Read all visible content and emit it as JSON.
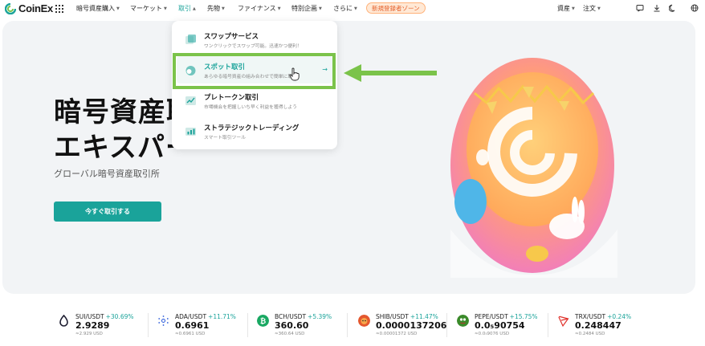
{
  "nav": {
    "logo": "CoinEx",
    "items": [
      {
        "label": "暗号資産購入",
        "active": false
      },
      {
        "label": "マーケット",
        "active": false
      },
      {
        "label": "取引",
        "active": true
      },
      {
        "label": "先物",
        "active": false
      },
      {
        "label": "ファイナンス",
        "active": false
      },
      {
        "label": "特別企画",
        "active": false
      },
      {
        "label": "さらに",
        "active": false
      }
    ],
    "promo": "新規登録者ゾーン",
    "assets": "資産",
    "orders": "注文"
  },
  "hero": {
    "title_line1": "暗号資産取",
    "title_line2": "エキスパー",
    "subtitle": "グローバル暗号資産取引所",
    "cta": "今すぐ取引する"
  },
  "menu": {
    "items": [
      {
        "title": "スワップサービス",
        "desc": "ワンクリックでスワップ可能。迅速かつ便利！"
      },
      {
        "title": "スポット取引",
        "desc": "あらゆる暗号資産の組み合わせで簡単に取引"
      },
      {
        "title": "プレトークン取引",
        "desc": "市場機会を把握しいち早く利益を獲得しよう"
      },
      {
        "title": "ストラテジックトレーディング",
        "desc": "スマート取引ツール"
      }
    ]
  },
  "tickers": [
    {
      "pair": "SUI/USDT",
      "change": "+30.69%",
      "price": "2.9289",
      "sub": "≈2.929 USD",
      "color": "#1a1a2e"
    },
    {
      "pair": "ADA/USDT",
      "change": "+11.71%",
      "price": "0.6961",
      "sub": "≈0.6961 USD",
      "color": "#2a5ada"
    },
    {
      "pair": "BCH/USDT",
      "change": "+5.39%",
      "price": "360.60",
      "sub": "≈360.64 USD",
      "color": "#19a862"
    },
    {
      "pair": "SHIB/USDT",
      "change": "+11.47%",
      "price": "0.0000137206",
      "sub": "≈0.00001372 USD",
      "color": "#e4572e"
    },
    {
      "pair": "PEPE/USDT",
      "change": "+15.75%",
      "price": "0.0₅90754",
      "sub": "≈0.0₅9076 USD",
      "color": "#3a8a2a"
    },
    {
      "pair": "TRX/USDT",
      "change": "+0.24%",
      "price": "0.248447",
      "sub": "≈0.2484 USD",
      "color": "#e0322c"
    }
  ],
  "colors": {
    "accent": "#1aa39a",
    "highlight": "#7bc34a",
    "promo": "#e5602a"
  }
}
